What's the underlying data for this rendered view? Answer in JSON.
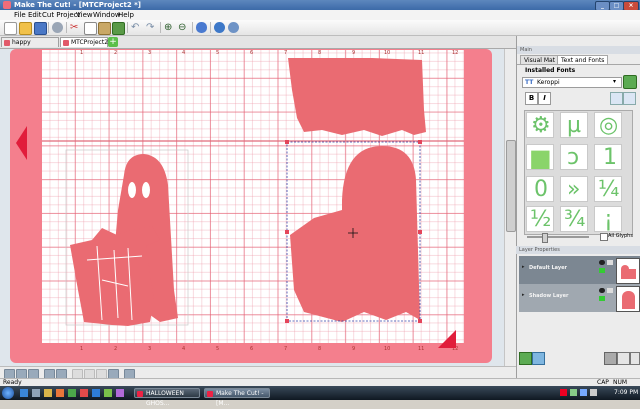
{
  "window": {
    "title": "Make The Cut! - [MTCProject2 *]"
  },
  "menu": [
    "File",
    "Edit",
    "Cut Project",
    "View",
    "Window",
    "Help"
  ],
  "toolbar": {
    "icons": [
      "new-file-icon",
      "open-folder-icon",
      "save-icon",
      "settings-icon",
      "cut-scissors-icon",
      "copy-icon",
      "paste-icon",
      "import-icon",
      "undo-icon",
      "redo-icon",
      "zoom-in-icon",
      "zoom-out-icon",
      "user-icon",
      "help-icon",
      "zoom-fit-icon"
    ]
  },
  "tabs": [
    {
      "label": "happy halloween.mtc",
      "active": false
    },
    {
      "label": "MTCProject2 *",
      "active": true
    }
  ],
  "ruler_top": [
    "1",
    "2",
    "3",
    "4",
    "5",
    "6",
    "7",
    "8",
    "9",
    "10",
    "11",
    "12"
  ],
  "ruler_bottom": [
    "1",
    "2",
    "3",
    "4",
    "5",
    "6",
    "7",
    "8",
    "9",
    "10",
    "11",
    "12"
  ],
  "panel": {
    "header": "Main",
    "tabs": [
      "Visual Mat",
      "Text and Fonts"
    ],
    "active_tab": "Text and Fonts",
    "installed_fonts_label": "Installed Fonts",
    "font_type": "TT",
    "font_name": "Keroppi",
    "bold_label": "B",
    "italic_label": "I",
    "glyphs": [
      "⚙",
      "µ",
      "◎",
      "■",
      "ↄ",
      "1",
      "0",
      "»",
      "¼",
      "½",
      "¾",
      "¡"
    ],
    "all_glyphs_label": "All Glyphs",
    "all_glyphs_checked": false
  },
  "layers": {
    "header": "Layer Properties",
    "items": [
      {
        "name": "Default Layer",
        "selected": false
      },
      {
        "name": "Shadow Layer",
        "selected": true
      }
    ]
  },
  "status": {
    "left": "Ready",
    "caps": "CAP",
    "num": "NUM"
  },
  "taskbar": {
    "tasks": [
      "HALLOWEEN GHOS...",
      "Make The Cut! - [M..."
    ],
    "clock": "7:09 PM"
  },
  "colors": {
    "mat_pink": "#f47f8d",
    "shape_fill": "#ea6b72",
    "glyph_green": "#8ad46a",
    "titlebar_blue": "#3c6aa8"
  }
}
